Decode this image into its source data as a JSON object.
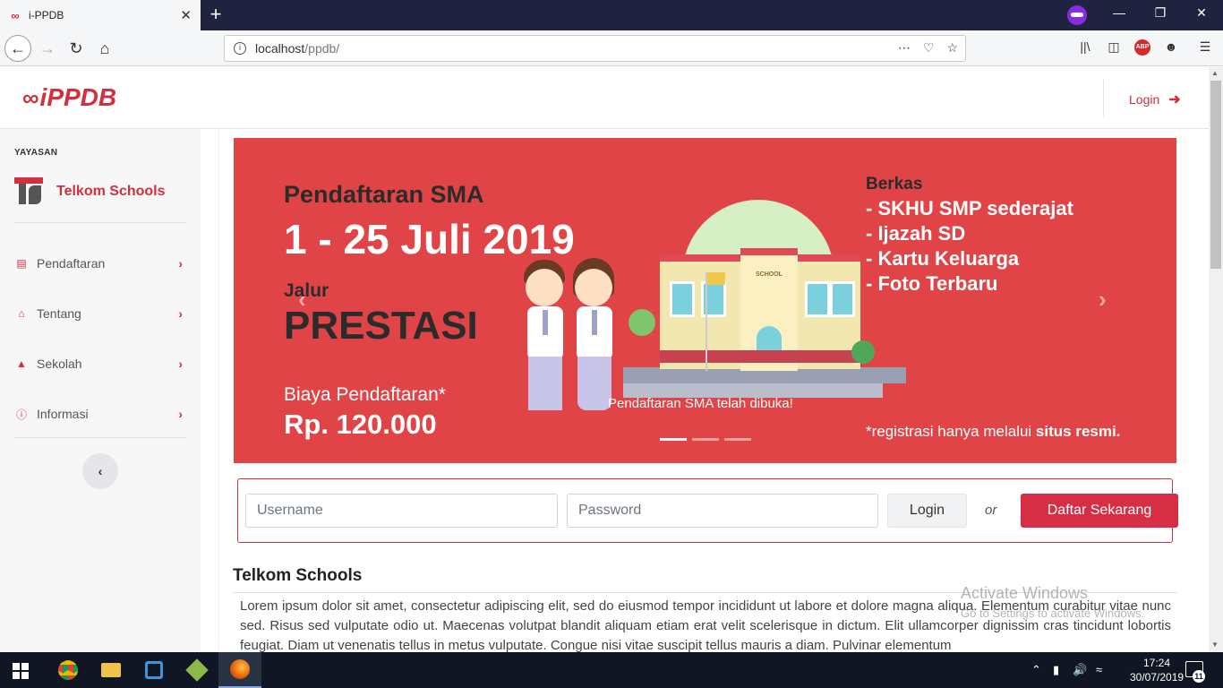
{
  "browser": {
    "tab_title": "i-PPDB",
    "url_host": "localhost",
    "url_path": "/ppdb/"
  },
  "header": {
    "logo_text": "iPPDB",
    "login_label": "Login"
  },
  "sidebar": {
    "yayasan_label": "YAYASAN",
    "school_name": "Telkom Schools",
    "items": [
      {
        "label": "Pendaftaran",
        "icon": "list-icon"
      },
      {
        "label": "Tentang",
        "icon": "building-icon"
      },
      {
        "label": "Sekolah",
        "icon": "graduation-cap-icon"
      },
      {
        "label": "Informasi",
        "icon": "info-icon"
      }
    ]
  },
  "banner": {
    "title": "Pendaftaran SMA",
    "date": "1 - 25 Juli 2019",
    "jalur": "Jalur",
    "prestasi": "PRESTASI",
    "biaya_label": "Biaya Pendaftaran*",
    "price": "Rp. 120.000",
    "berkas_title": "Berkas",
    "berkas_items": [
      "- SKHU SMP sederajat",
      "- Ijazah SD",
      "- Kartu Keluarga",
      "- Foto Terbaru"
    ],
    "note_prefix": "*registrasi hanya melalui ",
    "note_bold": "situs resmi.",
    "school_sign": "SCHOOL",
    "caption": "Pendaftaran SMA telah dibuka!",
    "slide_count": 3,
    "active_slide": 1
  },
  "login_form": {
    "username_placeholder": "Username",
    "password_placeholder": "Password",
    "login_button": "Login",
    "or_text": "or",
    "register_button": "Daftar Sekarang"
  },
  "about": {
    "title": "Telkom Schools",
    "body": "Lorem ipsum dolor sit amet, consectetur adipiscing elit, sed do eiusmod tempor incididunt ut labore et dolore magna aliqua. Elementum curabitur vitae nunc sed. Risus sed vulputate odio ut. Maecenas volutpat blandit aliquam etiam erat velit scelerisque in dictum. Elit ullamcorper dignissim cras tincidunt lobortis feugiat. Diam ut venenatis tellus in metus vulputate. Congue nisi vitae suscipit tellus mauris a diam. Pulvinar elementum"
  },
  "watermark": {
    "title": "Activate Windows",
    "subtitle": "Go to Settings to activate Windows."
  },
  "taskbar": {
    "time": "17:24",
    "date": "30/07/2019",
    "notification_count": "11"
  },
  "colors": {
    "brand_red": "#d2303e",
    "banner_red": "#e04446",
    "tab_bar": "#202340"
  }
}
